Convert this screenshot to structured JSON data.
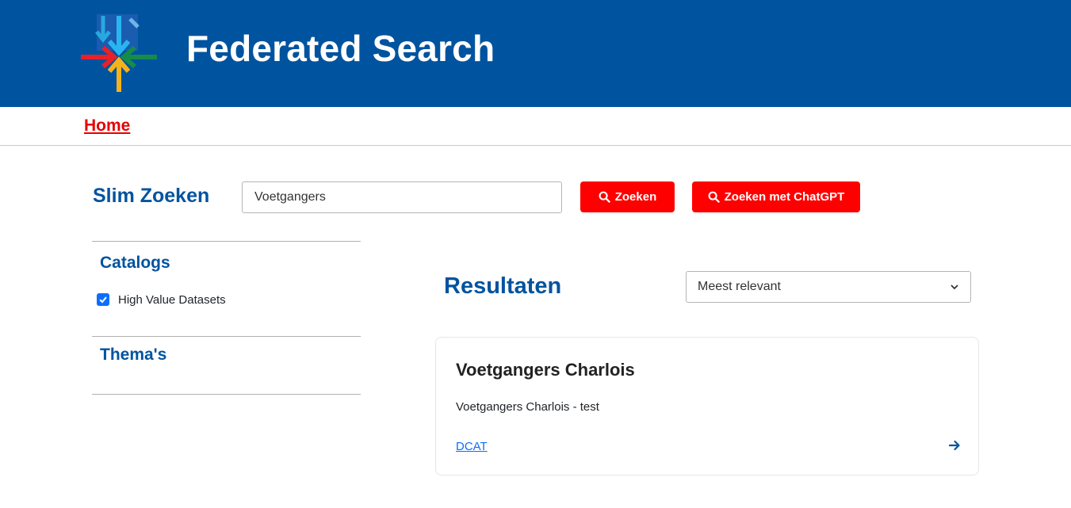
{
  "header": {
    "title": "Federated Search",
    "logo_icon": "converging-arrows-logo-icon"
  },
  "nav": {
    "home_label": "Home"
  },
  "search": {
    "label": "Slim Zoeken",
    "query": "Voetgangers",
    "search_button": "Zoeken",
    "chatgpt_button": "Zoeken met ChatGPT",
    "button_icon": "search-icon"
  },
  "filters": {
    "catalogs_heading": "Catalogs",
    "catalogs": [
      {
        "label": "High Value Datasets",
        "checked": true
      }
    ],
    "themes_heading": "Thema's"
  },
  "results": {
    "title": "Resultaten",
    "sort_selected": "Meest relevant",
    "items": [
      {
        "title": "Voetgangers Charlois",
        "description": "Voetgangers Charlois - test",
        "link": "DCAT",
        "action_icon": "arrow-right-icon"
      }
    ]
  },
  "colors": {
    "brand_blue": "#00539f",
    "accent_red": "#ff0000",
    "link_blue": "#0d6efd"
  }
}
